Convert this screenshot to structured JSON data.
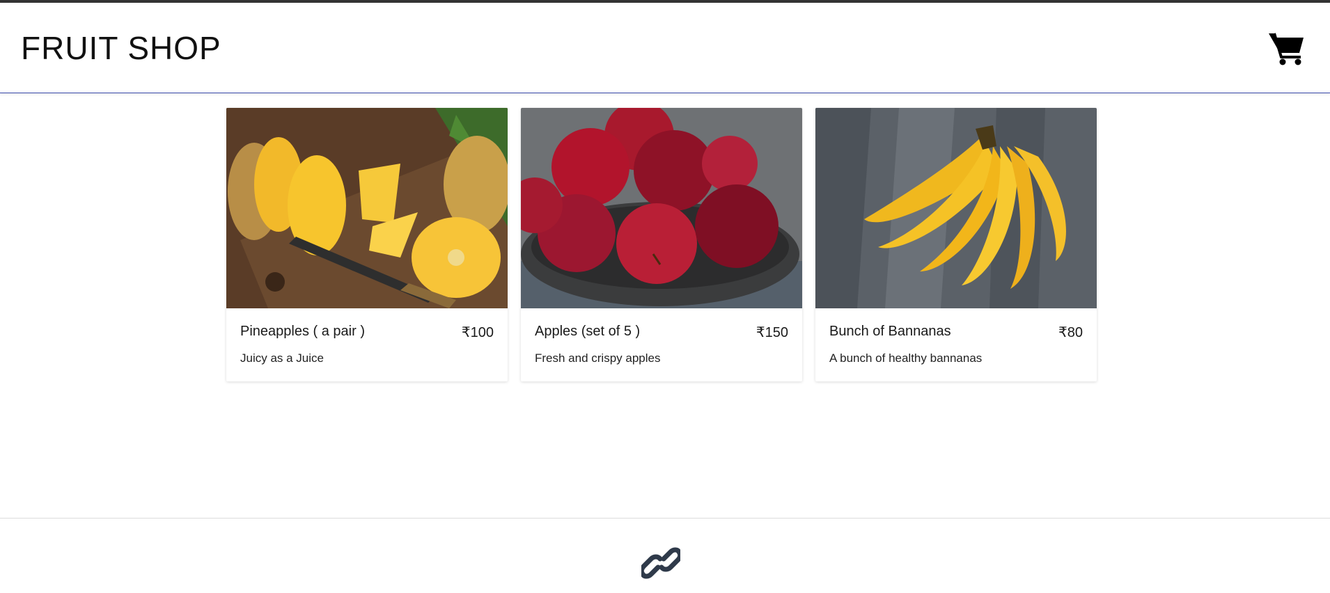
{
  "header": {
    "title": "FRUIT SHOP",
    "cart_icon": "shopping-cart-icon"
  },
  "products": [
    {
      "name": "Pineapples ( a pair )",
      "price": "₹100",
      "description": "Juicy as a Juice",
      "image": "pineapple-photo"
    },
    {
      "name": "Apples (set of 5 )",
      "price": "₹150",
      "description": "Fresh and crispy apples",
      "image": "apples-photo"
    },
    {
      "name": "Bunch of Bannanas",
      "price": "₹80",
      "description": "A bunch of healthy bannanas",
      "image": "bananas-photo"
    }
  ],
  "footer": {
    "icon": "link-icon"
  },
  "colors": {
    "topbar": "#333333",
    "header_border": "#3949ab",
    "footer_icon": "#2f3a4a"
  }
}
